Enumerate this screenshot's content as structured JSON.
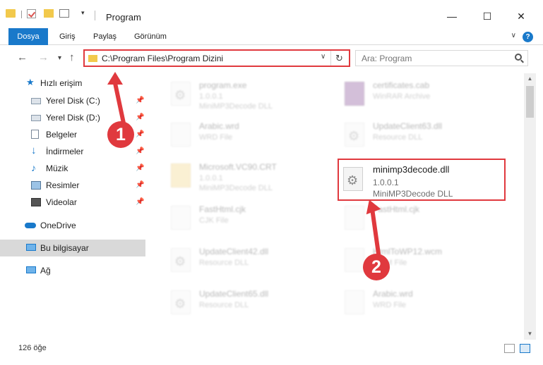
{
  "window": {
    "title": "Program",
    "minimize": "—",
    "maximize": "☐",
    "close": "✕"
  },
  "ribbon": {
    "tabs": [
      "Dosya",
      "Giriş",
      "Paylaş",
      "Görünüm"
    ],
    "help": "?"
  },
  "nav": {
    "back": "←",
    "forward": "→",
    "recent": "▾",
    "up": "↑",
    "address": "C:\\Program Files\\Program Dizini",
    "dropdown": "∨",
    "refresh": "↻"
  },
  "search": {
    "placeholder": "Ara: Program"
  },
  "sidebar": {
    "quick_access": "Hızlı erişim",
    "items": [
      {
        "label": "Yerel Disk (C:)",
        "icon": "drive-icon"
      },
      {
        "label": "Yerel Disk (D:)",
        "icon": "drive-icon"
      },
      {
        "label": "Belgeler",
        "icon": "documents-icon"
      },
      {
        "label": "İndirmeler",
        "icon": "downloads-icon"
      },
      {
        "label": "Müzik",
        "icon": "music-icon"
      },
      {
        "label": "Resimler",
        "icon": "pictures-icon"
      },
      {
        "label": "Videolar",
        "icon": "videos-icon"
      }
    ],
    "onedrive": "OneDrive",
    "this_pc": "Bu bilgisayar",
    "network": "Ağ"
  },
  "files": [
    {
      "name": "program.exe",
      "line1": "1.0.0.1",
      "line2": "MiniMP3Decode DLL"
    },
    {
      "name": "certificates.cab",
      "line1": "WinRAR Archive",
      "line2": ""
    },
    {
      "name": "Arabic.wrd",
      "line1": "WRD File",
      "line2": ""
    },
    {
      "name": "UpdateClient63.dll",
      "line1": "Resource DLL",
      "line2": ""
    },
    {
      "name": "Microsoft.VC90.CRT",
      "line1": "1.0.0.1",
      "line2": "MiniMP3Decode DLL"
    },
    {
      "name": "minimp3decode.dll",
      "line1": "1.0.0.1",
      "line2": "MiniMP3Decode DLL"
    },
    {
      "name": "FastHtml.cjk",
      "line1": "CJK File",
      "line2": ""
    },
    {
      "name": "FastHtml.cjk",
      "line1": "",
      "line2": ""
    },
    {
      "name": "UpdateClient42.dll",
      "line1": "Resource DLL",
      "line2": ""
    },
    {
      "name": "HtmlToWP12.wcm",
      "line1": "WCM File",
      "line2": ""
    },
    {
      "name": "UpdateClient65.dll",
      "line1": "Resource DLL",
      "line2": ""
    },
    {
      "name": "Arabic.wrd",
      "line1": "WRD File",
      "line2": ""
    }
  ],
  "status": {
    "count": "126 öğe"
  },
  "annotations": {
    "step1": "1",
    "step2": "2"
  },
  "colors": {
    "accent": "#1979ca",
    "highlight": "#e0393e",
    "selected": "#d9d9d9"
  }
}
